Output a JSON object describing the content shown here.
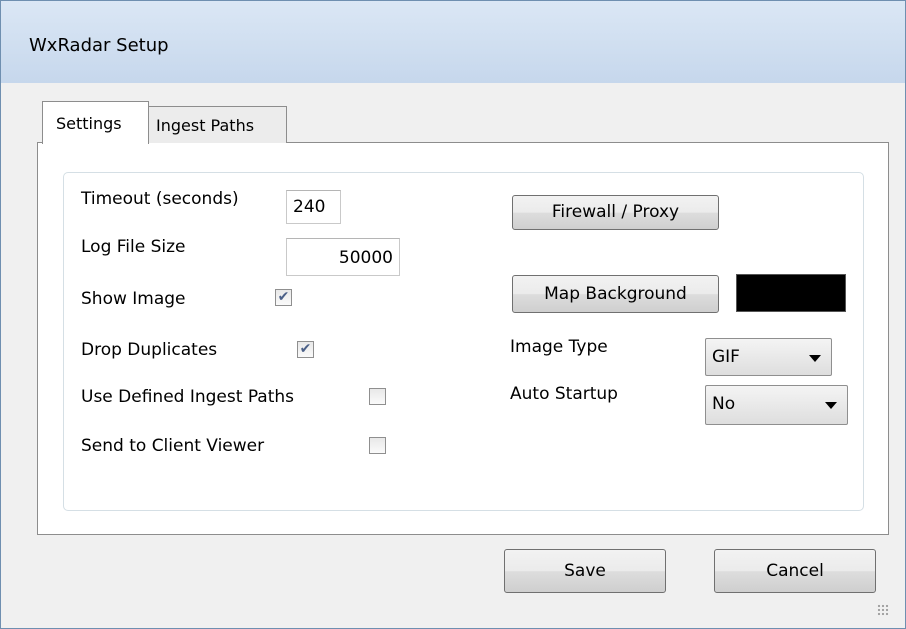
{
  "window": {
    "title": "WxRadar Setup"
  },
  "tabs": [
    {
      "label": "Settings",
      "active": true
    },
    {
      "label": "Ingest Paths",
      "active": false
    }
  ],
  "settings": {
    "timeout_label": "Timeout (seconds)",
    "timeout_value": "240",
    "logsize_label": "Log File Size",
    "logsize_value": "50000",
    "show_image_label": "Show Image",
    "show_image_checked": true,
    "drop_duplicates_label": "Drop Duplicates",
    "drop_duplicates_checked": true,
    "use_defined_label": "Use Defined Ingest Paths",
    "use_defined_checked": false,
    "send_client_label": "Send to Client Viewer",
    "send_client_checked": false,
    "firewall_button": "Firewall / Proxy",
    "map_background_button": "Map Background",
    "map_background_color": "#000000",
    "image_type_label": "Image Type",
    "image_type_value": "GIF",
    "auto_startup_label": "Auto Startup",
    "auto_startup_value": "No"
  },
  "footer": {
    "save_label": "Save",
    "cancel_label": "Cancel"
  },
  "icons": {
    "check": "✔",
    "resize_grip": "resize-grip-icon",
    "dropdown": "chevron-down-icon"
  }
}
